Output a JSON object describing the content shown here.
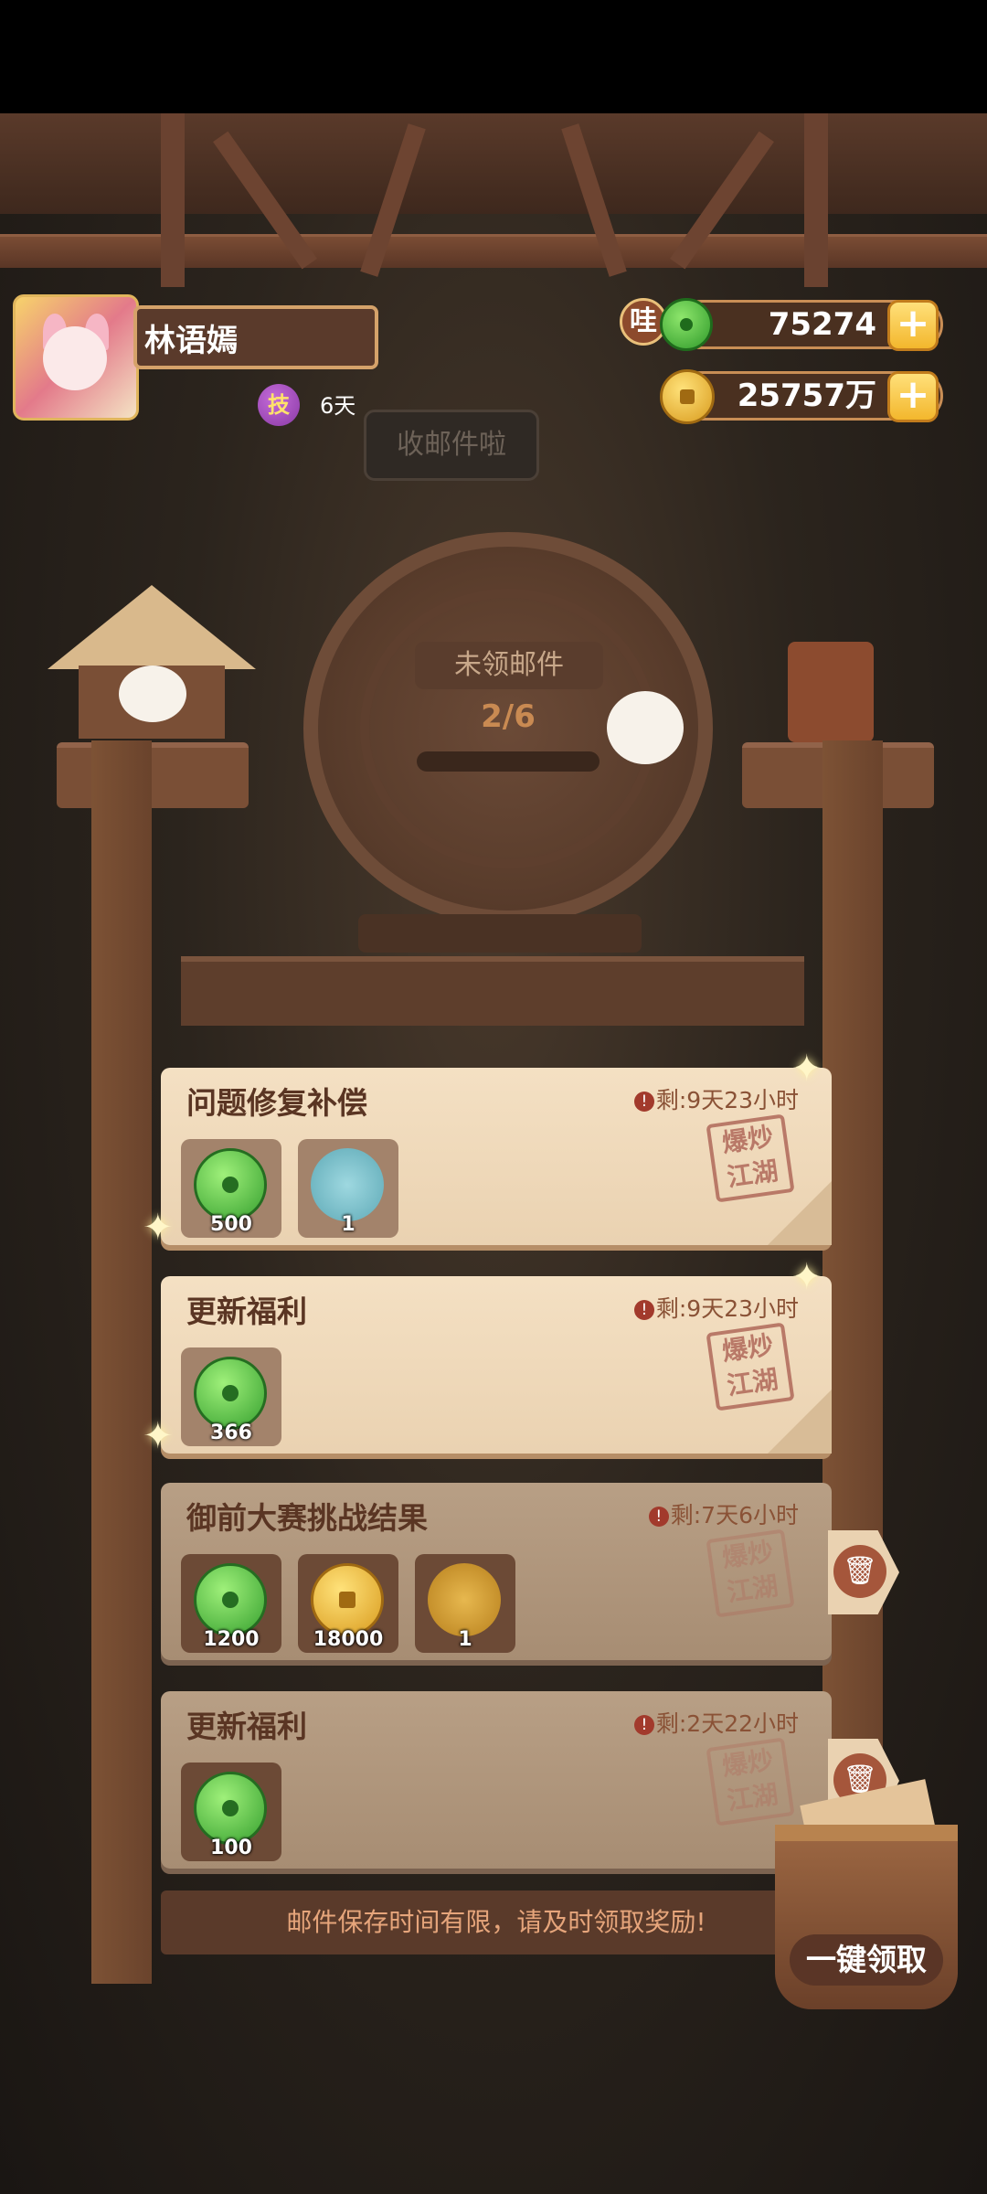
{
  "player": {
    "name": "林语嫣",
    "skill_badge": "技",
    "days": "6天"
  },
  "currency": {
    "wa_badge": "哇",
    "jade": "75274",
    "coins": "25757万",
    "plus": "+"
  },
  "bubble_text": "收邮件啦",
  "mailbox": {
    "title": "未领邮件",
    "count": "2/6"
  },
  "mails": [
    {
      "title": "问题修复补偿",
      "remain": "剩:9天23小时",
      "stamp": "爆炒江湖",
      "items": [
        {
          "icon": "jade-icon",
          "qty": "500"
        },
        {
          "icon": "scroll-icon",
          "qty": "1"
        }
      ]
    },
    {
      "title": "更新福利",
      "remain": "剩:9天23小时",
      "stamp": "爆炒江湖",
      "items": [
        {
          "icon": "jade-icon",
          "qty": "366"
        }
      ]
    },
    {
      "title": "御前大赛挑战结果",
      "remain": "剩:7天6小时",
      "stamp": "爆炒江湖",
      "items": [
        {
          "icon": "jade-icon",
          "qty": "1200"
        },
        {
          "icon": "coin-icon",
          "qty": "18000"
        },
        {
          "icon": "shell-icon",
          "qty": "1"
        }
      ]
    },
    {
      "title": "更新福利",
      "remain": "剩:2天22小时",
      "stamp": "爆炒江湖",
      "items": [
        {
          "icon": "jade-icon",
          "qty": "100"
        }
      ]
    }
  ],
  "notice": "邮件保存时间有限，请及时领取奖励!",
  "claim_all": "一键领取",
  "colors": {
    "card": "#f4e0c3",
    "card_claimed": "#b89f85",
    "accent_red": "#a5563b",
    "plus_gold": "#f3b72d"
  }
}
